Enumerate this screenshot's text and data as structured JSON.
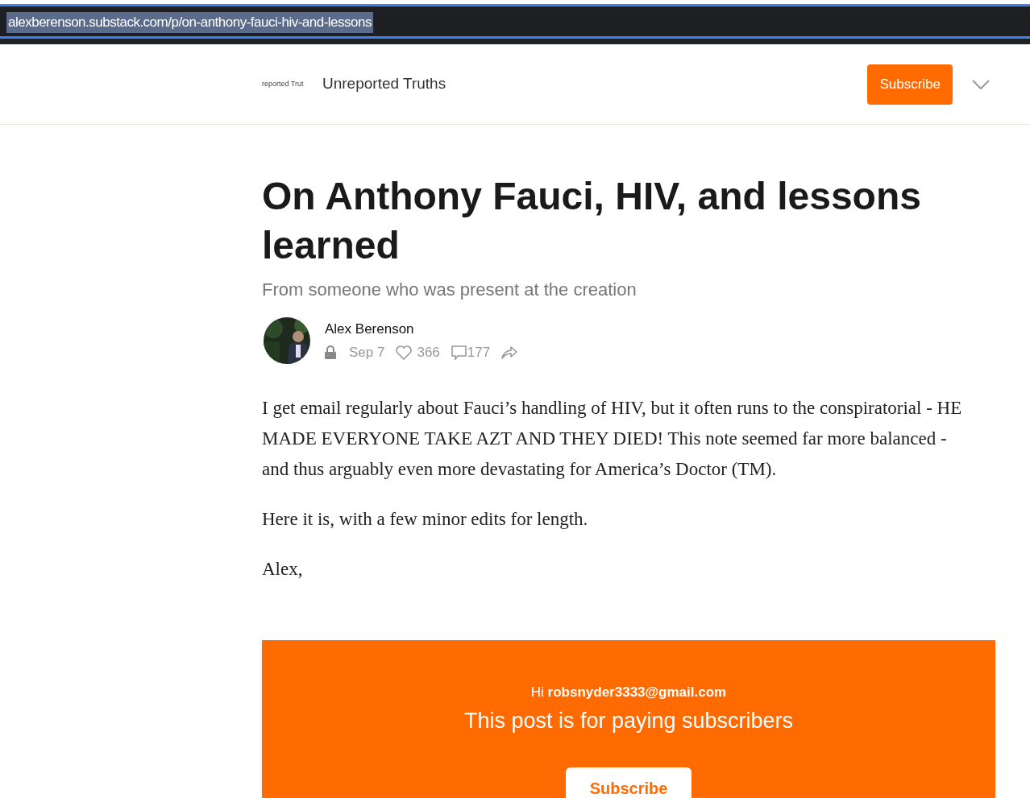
{
  "address_bar": {
    "url": "alexberenson.substack.com/p/on-anthony-fauci-hiv-and-lessons",
    "selected": true
  },
  "header": {
    "logo_text": "reported Trut",
    "publication": "Unreported Truths",
    "subscribe": "Subscribe"
  },
  "post": {
    "title": "On Anthony Fauci, HIV, and lessons learned",
    "subtitle": "From someone who was present at the creation",
    "author": "Alex Berenson",
    "locked": true,
    "date": "Sep 7",
    "likes": "366",
    "comments": "177",
    "paragraphs": [
      "I get email regularly about Fauci’s handling of HIV, but it often runs to the conspiratorial - HE MADE EVERYONE TAKE AZT AND THEY DIED! This note seemed far more balanced - and thus arguably even more devastating for America’s Doctor (TM).",
      "Here it is, with a few minor edits for length.",
      "Alex,"
    ]
  },
  "paywall": {
    "greeting": "Hi",
    "email": "robsnyder3333@gmail.com",
    "message": "This post is for paying subscribers",
    "subscribe": "Subscribe"
  }
}
